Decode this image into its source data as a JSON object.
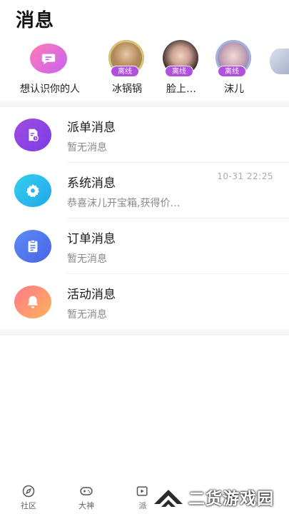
{
  "header": {
    "title": "消息"
  },
  "contacts": {
    "wish_label": "想认识你的人",
    "people": [
      {
        "name": "冰锅锅",
        "status": "离线"
      },
      {
        "name": "脸上…",
        "status": "离线"
      },
      {
        "name": "沫儿",
        "status": "离线"
      }
    ]
  },
  "messages": [
    {
      "title": "派单消息",
      "subtitle": "暂无消息",
      "time": ""
    },
    {
      "title": "系统消息",
      "subtitle": "恭喜沫儿开宝箱,获得价…",
      "time": "10-31 22:25"
    },
    {
      "title": "订单消息",
      "subtitle": "暂无消息",
      "time": ""
    },
    {
      "title": "活动消息",
      "subtitle": "暂无消息",
      "time": ""
    }
  ],
  "tabbar": {
    "community": "社区",
    "master": "大神",
    "dispatch": "派"
  },
  "watermark": {
    "text": "二货游戏园"
  }
}
